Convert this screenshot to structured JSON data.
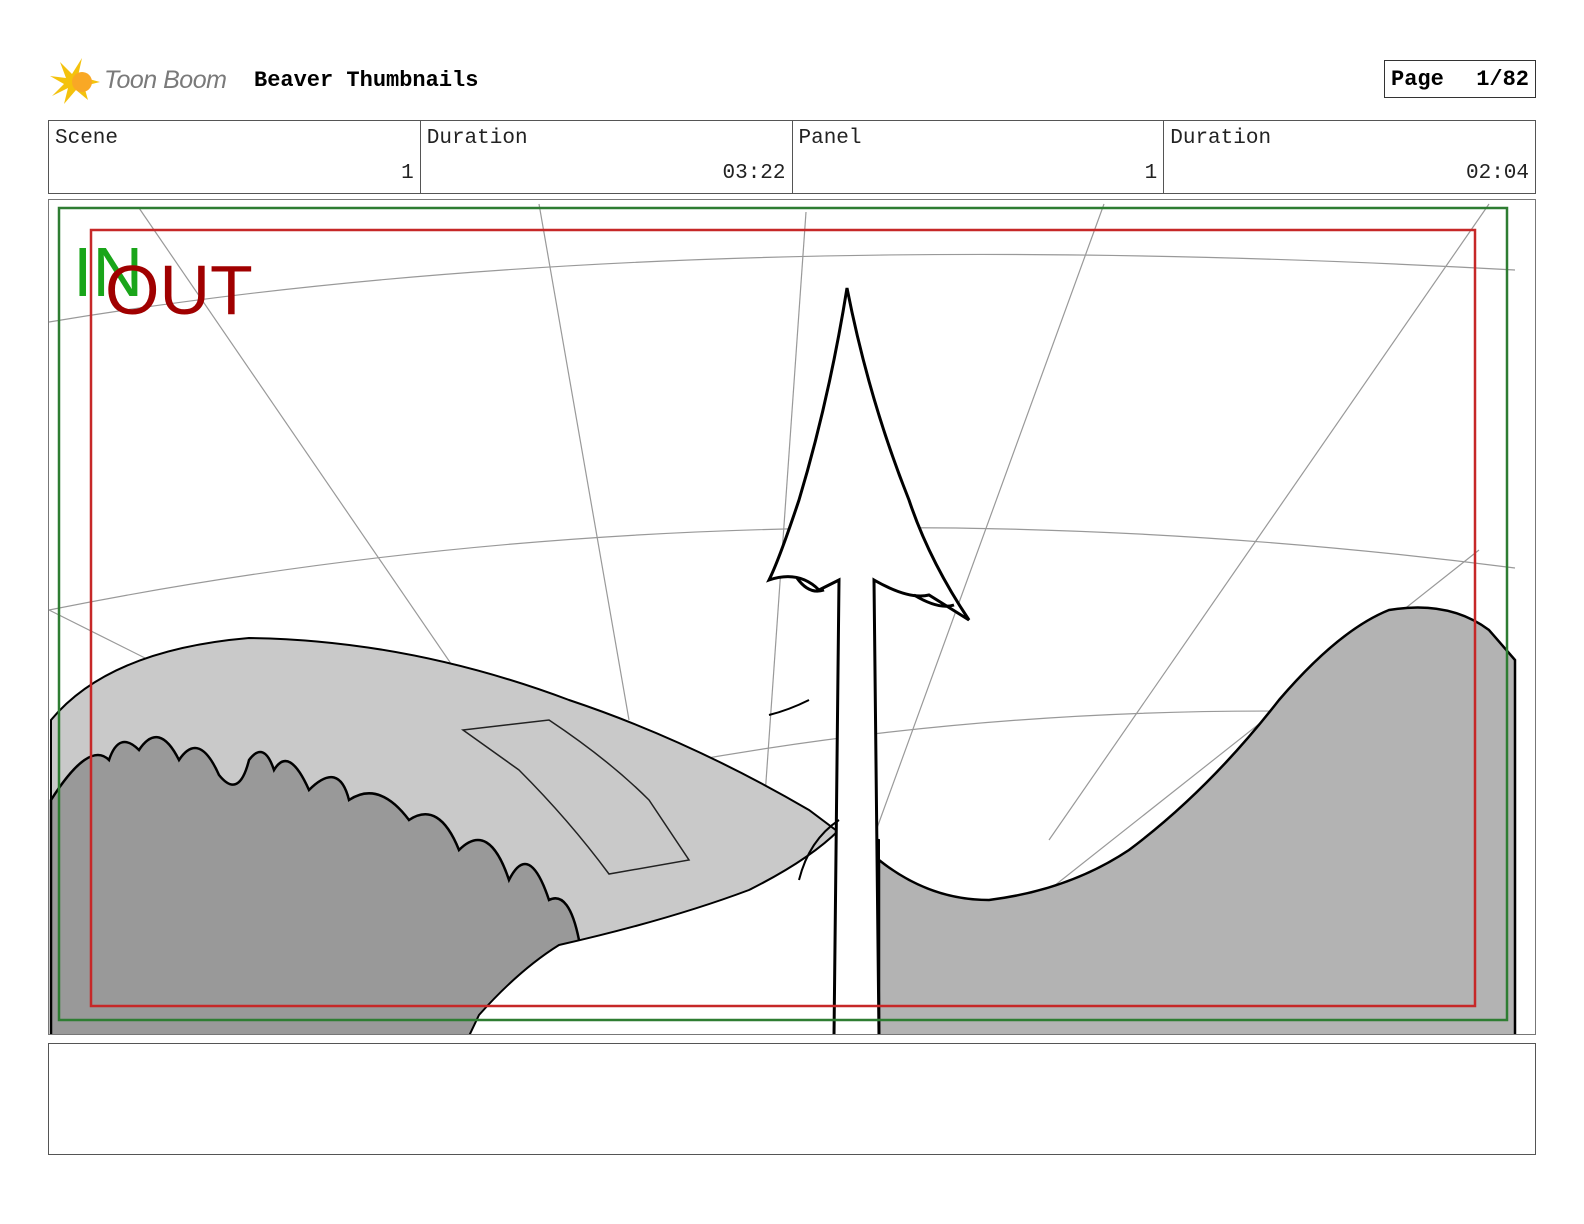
{
  "header": {
    "brand": "Toon Boom",
    "project_title": "Beaver Thumbnails",
    "page_label": "Page",
    "page_number": "1/82"
  },
  "info": {
    "scene_label": "Scene",
    "scene_value": "1",
    "scene_duration_label": "Duration",
    "scene_duration_value": "03:22",
    "panel_label": "Panel",
    "panel_value": "1",
    "panel_duration_label": "Duration",
    "panel_duration_value": "02:04"
  },
  "panel": {
    "in_label": "IN",
    "out_label": "OUT",
    "colors": {
      "in": "#1aa51a",
      "out": "#a00000",
      "safe_frame": "#2e7d32",
      "out_frame": "#c62828"
    }
  },
  "caption": {
    "text": ""
  }
}
